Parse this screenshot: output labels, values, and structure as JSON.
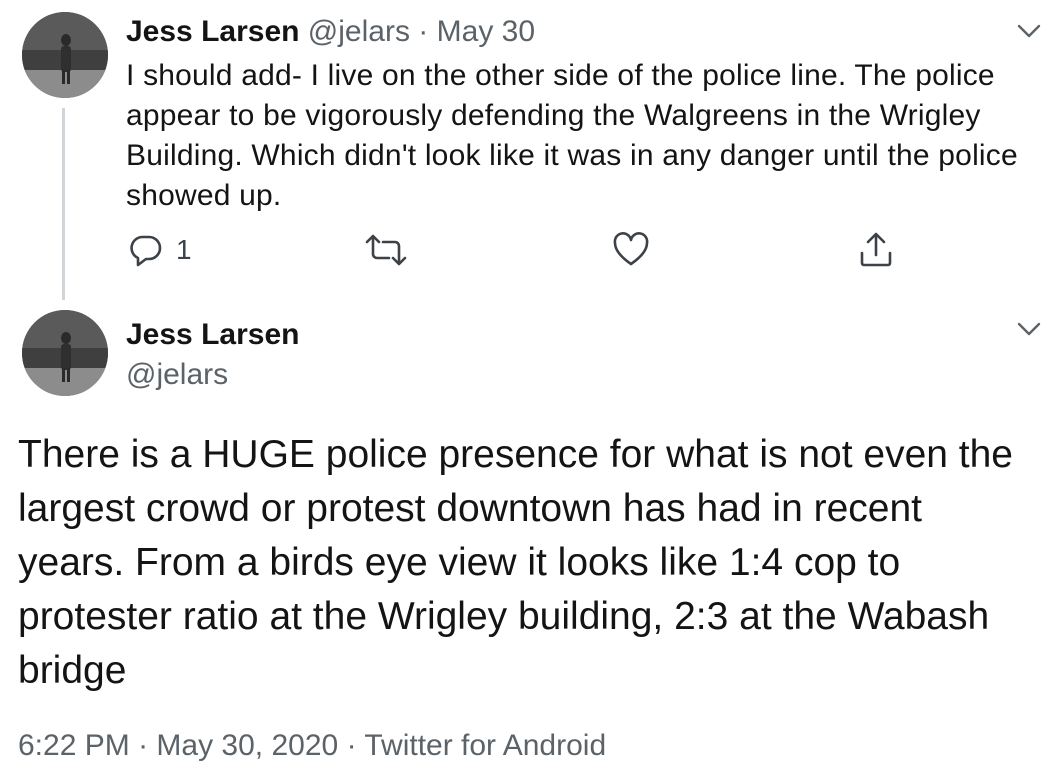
{
  "reply_tweet": {
    "author_name": "Jess Larsen",
    "handle": "@jelars",
    "separator": "·",
    "date": "May 30",
    "text": "I should add- I live on the other side of the police line. The police appear to be vigorously defending the Walgreens in the Wrigley Building. Which didn't look like it was in any danger until the police showed up.",
    "actions": {
      "reply_count": "1",
      "retweet_count": "",
      "like_count": ""
    },
    "icons": [
      "chevron-down-icon",
      "reply-icon",
      "retweet-icon",
      "heart-icon",
      "share-icon"
    ]
  },
  "main_tweet": {
    "author_name": "Jess Larsen",
    "handle": "@jelars",
    "text": "There is a HUGE police presence for what is not even the largest crowd or protest downtown has had in recent years. From a birds eye view it looks like 1:4 cop to protester ratio at the Wrigley building, 2:3 at the Wabash bridge",
    "time": "6:22 PM",
    "separator": "·",
    "date": "May 30, 2020",
    "source": "Twitter for Android",
    "icons": [
      "chevron-down-icon"
    ]
  },
  "colors": {
    "text_primary": "#141414",
    "text_secondary": "#5b6268",
    "thread_line": "#cfd5d9",
    "icon_gray": "#5b6268"
  }
}
